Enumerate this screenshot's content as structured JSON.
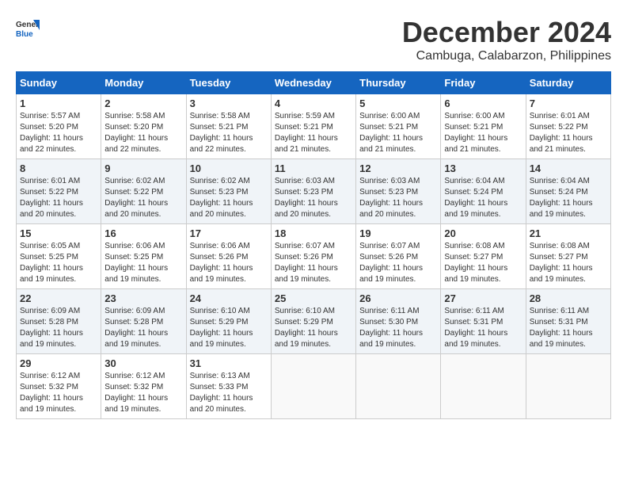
{
  "header": {
    "logo_general": "General",
    "logo_blue": "Blue",
    "month_title": "December 2024",
    "location": "Cambuga, Calabarzon, Philippines"
  },
  "calendar": {
    "days_of_week": [
      "Sunday",
      "Monday",
      "Tuesday",
      "Wednesday",
      "Thursday",
      "Friday",
      "Saturday"
    ],
    "weeks": [
      [
        null,
        {
          "day": "2",
          "sunrise": "5:58 AM",
          "sunset": "5:20 PM",
          "daylight": "11 hours and 22 minutes."
        },
        {
          "day": "3",
          "sunrise": "5:58 AM",
          "sunset": "5:21 PM",
          "daylight": "11 hours and 22 minutes."
        },
        {
          "day": "4",
          "sunrise": "5:59 AM",
          "sunset": "5:21 PM",
          "daylight": "11 hours and 21 minutes."
        },
        {
          "day": "5",
          "sunrise": "6:00 AM",
          "sunset": "5:21 PM",
          "daylight": "11 hours and 21 minutes."
        },
        {
          "day": "6",
          "sunrise": "6:00 AM",
          "sunset": "5:21 PM",
          "daylight": "11 hours and 21 minutes."
        },
        {
          "day": "7",
          "sunrise": "6:01 AM",
          "sunset": "5:22 PM",
          "daylight": "11 hours and 21 minutes."
        }
      ],
      [
        {
          "day": "1",
          "sunrise": "5:57 AM",
          "sunset": "5:20 PM",
          "daylight": "11 hours and 22 minutes."
        },
        {
          "day": "9",
          "sunrise": "6:02 AM",
          "sunset": "5:22 PM",
          "daylight": "11 hours and 20 minutes."
        },
        {
          "day": "10",
          "sunrise": "6:02 AM",
          "sunset": "5:23 PM",
          "daylight": "11 hours and 20 minutes."
        },
        {
          "day": "11",
          "sunrise": "6:03 AM",
          "sunset": "5:23 PM",
          "daylight": "11 hours and 20 minutes."
        },
        {
          "day": "12",
          "sunrise": "6:03 AM",
          "sunset": "5:23 PM",
          "daylight": "11 hours and 20 minutes."
        },
        {
          "day": "13",
          "sunrise": "6:04 AM",
          "sunset": "5:24 PM",
          "daylight": "11 hours and 19 minutes."
        },
        {
          "day": "14",
          "sunrise": "6:04 AM",
          "sunset": "5:24 PM",
          "daylight": "11 hours and 19 minutes."
        }
      ],
      [
        {
          "day": "8",
          "sunrise": "6:01 AM",
          "sunset": "5:22 PM",
          "daylight": "11 hours and 20 minutes."
        },
        {
          "day": "16",
          "sunrise": "6:06 AM",
          "sunset": "5:25 PM",
          "daylight": "11 hours and 19 minutes."
        },
        {
          "day": "17",
          "sunrise": "6:06 AM",
          "sunset": "5:26 PM",
          "daylight": "11 hours and 19 minutes."
        },
        {
          "day": "18",
          "sunrise": "6:07 AM",
          "sunset": "5:26 PM",
          "daylight": "11 hours and 19 minutes."
        },
        {
          "day": "19",
          "sunrise": "6:07 AM",
          "sunset": "5:26 PM",
          "daylight": "11 hours and 19 minutes."
        },
        {
          "day": "20",
          "sunrise": "6:08 AM",
          "sunset": "5:27 PM",
          "daylight": "11 hours and 19 minutes."
        },
        {
          "day": "21",
          "sunrise": "6:08 AM",
          "sunset": "5:27 PM",
          "daylight": "11 hours and 19 minutes."
        }
      ],
      [
        {
          "day": "15",
          "sunrise": "6:05 AM",
          "sunset": "5:25 PM",
          "daylight": "11 hours and 19 minutes."
        },
        {
          "day": "23",
          "sunrise": "6:09 AM",
          "sunset": "5:28 PM",
          "daylight": "11 hours and 19 minutes."
        },
        {
          "day": "24",
          "sunrise": "6:10 AM",
          "sunset": "5:29 PM",
          "daylight": "11 hours and 19 minutes."
        },
        {
          "day": "25",
          "sunrise": "6:10 AM",
          "sunset": "5:29 PM",
          "daylight": "11 hours and 19 minutes."
        },
        {
          "day": "26",
          "sunrise": "6:11 AM",
          "sunset": "5:30 PM",
          "daylight": "11 hours and 19 minutes."
        },
        {
          "day": "27",
          "sunrise": "6:11 AM",
          "sunset": "5:31 PM",
          "daylight": "11 hours and 19 minutes."
        },
        {
          "day": "28",
          "sunrise": "6:11 AM",
          "sunset": "5:31 PM",
          "daylight": "11 hours and 19 minutes."
        }
      ],
      [
        {
          "day": "22",
          "sunrise": "6:09 AM",
          "sunset": "5:28 PM",
          "daylight": "11 hours and 19 minutes."
        },
        {
          "day": "30",
          "sunrise": "6:12 AM",
          "sunset": "5:32 PM",
          "daylight": "11 hours and 19 minutes."
        },
        {
          "day": "31",
          "sunrise": "6:13 AM",
          "sunset": "5:33 PM",
          "daylight": "11 hours and 20 minutes."
        },
        null,
        null,
        null,
        null
      ],
      [
        {
          "day": "29",
          "sunrise": "6:12 AM",
          "sunset": "5:32 PM",
          "daylight": "11 hours and 19 minutes."
        },
        null,
        null,
        null,
        null,
        null,
        null
      ]
    ]
  }
}
